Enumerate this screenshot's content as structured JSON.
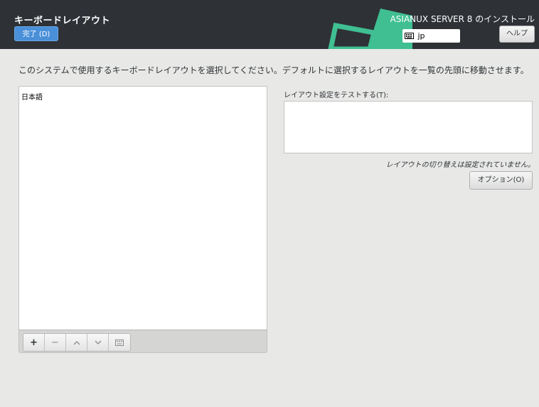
{
  "header": {
    "title": "キーボードレイアウト",
    "done_label": "完了 (D)",
    "product_name": "ASIANUX SERVER 8 のインストール",
    "layout_indicator": "jp",
    "help_label": "ヘルプ",
    "brand_color": "#3fbf92"
  },
  "main": {
    "instruction": "このシステムで使用するキーボードレイアウトを選択してください。デフォルトに選択するレイアウトを一覧の先頭に移動させます。",
    "layouts": [
      {
        "label": "日本語"
      }
    ],
    "toolbar": {
      "add_label": "+",
      "remove_label": "−",
      "up_icon": "chevron-up-icon",
      "down_icon": "chevron-down-icon",
      "preview_icon": "keyboard-icon"
    },
    "test_label": "レイアウト設定をテストする(T):",
    "test_value": "",
    "switch_note": "レイアウトの切り替えは設定されていません。",
    "options_label": "オプション(O)"
  }
}
